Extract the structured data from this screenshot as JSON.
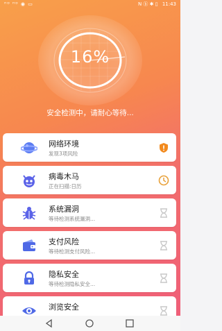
{
  "status_bar": {
    "left_text": "ᴴᴰ ᴴᴰ ◉ ▭",
    "right_text": "N ⓑ ✱ ▯",
    "time": "11:43"
  },
  "gauge": {
    "percent_text": "16%",
    "progress": 0.16,
    "status_text": "安全检测中，请耐心等待..."
  },
  "items": [
    {
      "icon": "planet-icon",
      "title": "网络环境",
      "subtitle": "发现3项风险",
      "state": "warning-shield-icon",
      "state_color": "#f28a1e",
      "icon_color": "#5b7cf2"
    },
    {
      "icon": "devil-virus-icon",
      "title": "病毒木马",
      "subtitle": "正在扫描:日历",
      "state": "clock-icon",
      "state_color": "#e8a13a",
      "icon_color": "#5b63e8"
    },
    {
      "icon": "bug-icon",
      "title": "系统漏洞",
      "subtitle": "等待检测系统漏洞...",
      "state": "hourglass-icon",
      "state_color": "#c8c8c8",
      "icon_color": "#5b63e8"
    },
    {
      "icon": "wallet-icon",
      "title": "支付风险",
      "subtitle": "等待检测支付风险...",
      "state": "hourglass-icon",
      "state_color": "#c8c8c8",
      "icon_color": "#4f69e6"
    },
    {
      "icon": "lock-icon",
      "title": "隐私安全",
      "subtitle": "等待检测隐私安全...",
      "state": "hourglass-icon",
      "state_color": "#c8c8c8",
      "icon_color": "#4f69e6"
    },
    {
      "icon": "eye-icon",
      "title": "浏览安全",
      "subtitle": "",
      "state": "hourglass-icon",
      "state_color": "#c8c8c8",
      "icon_color": "#4f69e6"
    }
  ],
  "nav": {
    "back": "back-triangle-icon",
    "home": "home-circle-icon",
    "recents": "recents-square-icon"
  }
}
